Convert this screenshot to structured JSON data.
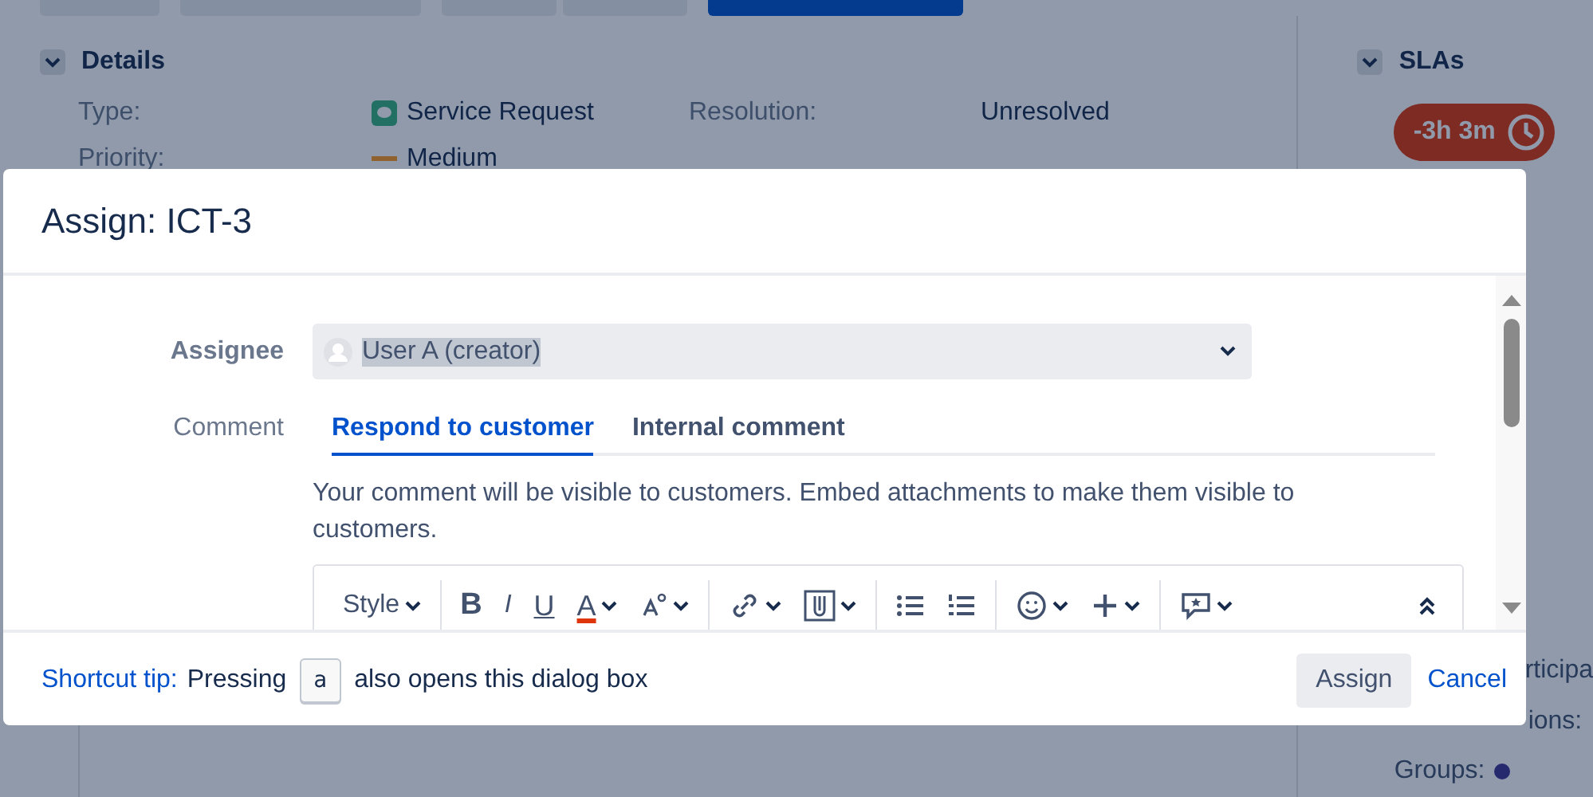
{
  "details": {
    "title": "Details",
    "expanded": true,
    "fields": [
      {
        "label": "Type:",
        "value": "Service Request",
        "kind": "type"
      },
      {
        "label": "Resolution:",
        "value": "Unresolved",
        "kind": "plain"
      },
      {
        "label": "Priority:",
        "value": "Medium",
        "kind": "priority"
      }
    ]
  },
  "slas": {
    "title": "SLAs",
    "expanded": true,
    "timer": "-3h 3m",
    "breached": true
  },
  "side_labels": [
    "rticipa",
    "ions:",
    "Groups:"
  ],
  "dialog": {
    "title": "Assign: ICT-3",
    "assignee": {
      "label": "Assignee",
      "value": "User A (creator)"
    },
    "comment": {
      "label": "Comment",
      "tabs": [
        {
          "label": "Respond to customer",
          "selected": true
        },
        {
          "label": "Internal comment",
          "selected": false
        }
      ],
      "notice": "Your comment will be visible to customers. Embed attachments to make them visible to customers.",
      "toolbar": [
        [
          {
            "kind": "style",
            "label": "Style",
            "menu": true
          }
        ],
        [
          {
            "kind": "bold",
            "label": "B",
            "menu": false
          },
          {
            "kind": "italic",
            "label": "I",
            "menu": false
          },
          {
            "kind": "underline",
            "label": "U",
            "menu": false
          },
          {
            "kind": "text-color",
            "label": "A",
            "menu": true
          },
          {
            "kind": "effects",
            "menu": true
          }
        ],
        [
          {
            "kind": "link",
            "menu": true
          },
          {
            "kind": "attachment",
            "menu": true
          }
        ],
        [
          {
            "kind": "bullets",
            "menu": false
          },
          {
            "kind": "numbering",
            "menu": false
          }
        ],
        [
          {
            "kind": "emoji",
            "menu": true
          },
          {
            "kind": "insert",
            "menu": true
          }
        ],
        [
          {
            "kind": "feedback",
            "menu": true
          }
        ]
      ]
    },
    "footer": {
      "tip_link": "Shortcut tip:",
      "tip_before": "Pressing",
      "key": "a",
      "tip_after": "also opens this dialog box",
      "buttons": [
        {
          "label": "Assign",
          "kind": "secondary"
        },
        {
          "label": "Cancel",
          "kind": "link"
        }
      ]
    }
  }
}
